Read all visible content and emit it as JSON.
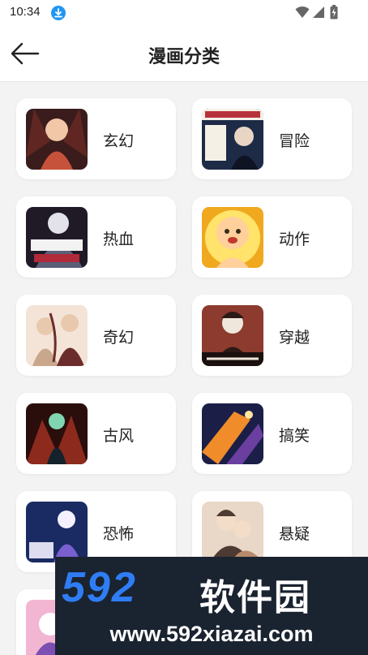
{
  "status_bar": {
    "time": "10:34"
  },
  "header": {
    "title": "漫画分类"
  },
  "categories": [
    {
      "label": "玄幻",
      "cover_icon": "cover-xuanhuan-icon",
      "cover_colors": [
        "#3a1c1c",
        "#c7523b",
        "#f1c7a8"
      ]
    },
    {
      "label": "冒险",
      "cover_icon": "cover-maoxian-icon",
      "cover_colors": [
        "#1d2b47",
        "#f5f0e6",
        "#b7323b"
      ]
    },
    {
      "label": "热血",
      "cover_icon": "cover-rexue-icon",
      "cover_colors": [
        "#1f1a26",
        "#5b5f78",
        "#e3e1ea"
      ]
    },
    {
      "label": "动作",
      "cover_icon": "cover-dongzuo-icon",
      "cover_colors": [
        "#f0a81e",
        "#ffe36a",
        "#ffcf9c"
      ]
    },
    {
      "label": "奇幻",
      "cover_icon": "cover-qihuan-icon",
      "cover_colors": [
        "#f3e4d7",
        "#c9a78c",
        "#6b2c2c"
      ]
    },
    {
      "label": "穿越",
      "cover_icon": "cover-chuanyue-icon",
      "cover_colors": [
        "#2b1a17",
        "#8c3b2e",
        "#efe7dc"
      ]
    },
    {
      "label": "古风",
      "cover_icon": "cover-gufeng-icon",
      "cover_colors": [
        "#2a0e0c",
        "#8d2a1e",
        "#7fd6b1"
      ]
    },
    {
      "label": "搞笑",
      "cover_icon": "cover-gaoxiao-icon",
      "cover_colors": [
        "#1b1f47",
        "#f08c2a",
        "#6a3fa0"
      ]
    },
    {
      "label": "恐怖",
      "cover_icon": "cover-kongbu-icon",
      "cover_colors": [
        "#1a2a63",
        "#7a5fd0",
        "#f4f1ff"
      ]
    },
    {
      "label": "悬疑",
      "cover_icon": "cover-xuanyi-icon",
      "cover_colors": [
        "#e9d8c8",
        "#4c3a33",
        "#b88a6b"
      ]
    },
    {
      "label": "",
      "cover_icon": "cover-partial-icon",
      "cover_colors": [
        "#f3b6d2",
        "#7c4fb3",
        "#ffffff"
      ]
    }
  ],
  "watermark": {
    "logo_number": "592",
    "logo_text": "软件园",
    "url": "www.592xiazai.com"
  },
  "colors": {
    "background": "#f3f3f3",
    "card": "#ffffff",
    "accent_blue": "#2196f3",
    "watermark_bg": "#1a2330",
    "watermark_blue": "#2f7df4"
  }
}
